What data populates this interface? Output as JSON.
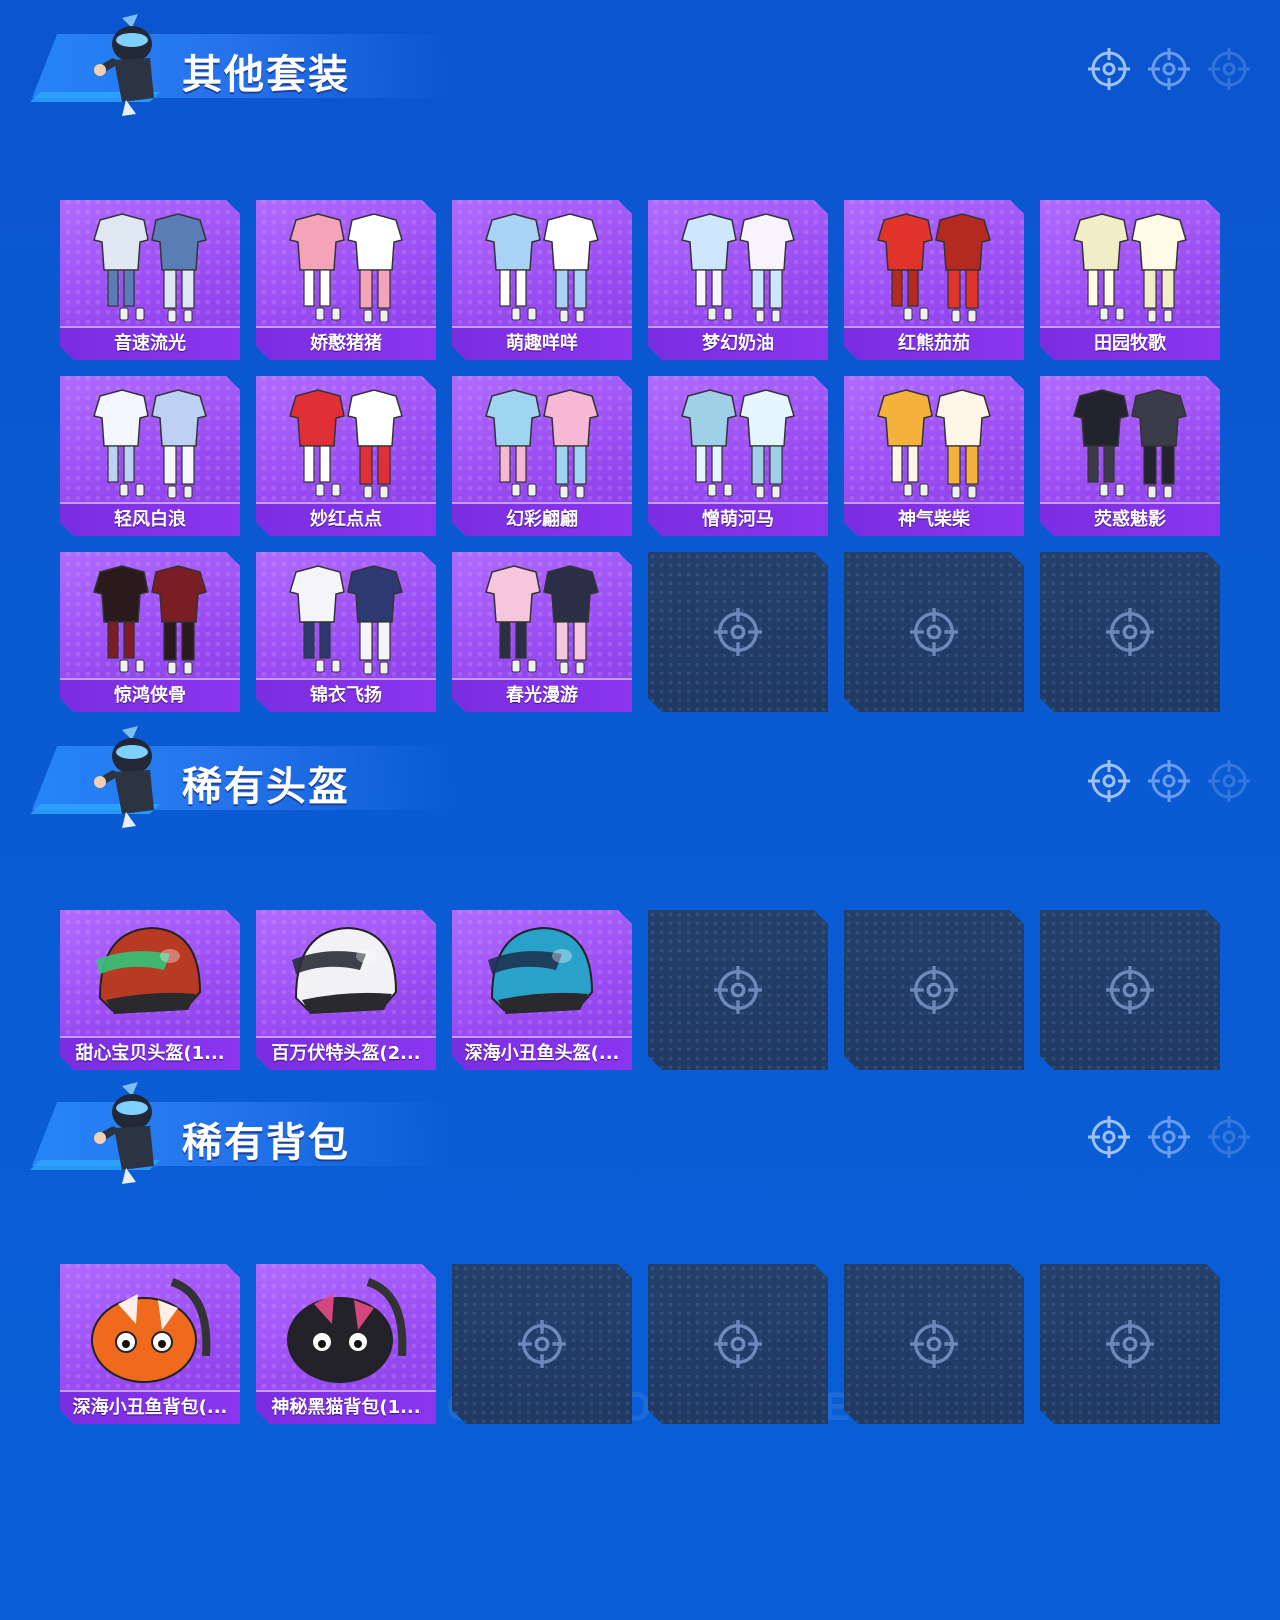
{
  "sections": [
    {
      "title": "其他套装",
      "items": [
        {
          "label": "音速流光",
          "kind": "outfit",
          "colors": [
            "#dfe7f2",
            "#5a7db5"
          ]
        },
        {
          "label": "娇憨猪猪",
          "kind": "outfit",
          "colors": [
            "#f5a3b8",
            "#ffffff"
          ]
        },
        {
          "label": "萌趣咩咩",
          "kind": "outfit",
          "colors": [
            "#a9d3f5",
            "#ffffff"
          ]
        },
        {
          "label": "梦幻奶油",
          "kind": "outfit",
          "colors": [
            "#cfe6ff",
            "#f7f4ff"
          ]
        },
        {
          "label": "红熊茄茄",
          "kind": "outfit",
          "colors": [
            "#e0342a",
            "#b52a20"
          ]
        },
        {
          "label": "田园牧歌",
          "kind": "outfit",
          "colors": [
            "#f1edc6",
            "#fffbe6"
          ]
        },
        {
          "label": "轻风白浪",
          "kind": "outfit",
          "colors": [
            "#f3f5ff",
            "#bcd1f4"
          ]
        },
        {
          "label": "妙红点点",
          "kind": "outfit",
          "colors": [
            "#e02f36",
            "#ffffff"
          ]
        },
        {
          "label": "幻彩翩翩",
          "kind": "outfit",
          "colors": [
            "#9fd5f0",
            "#f7b8d3"
          ]
        },
        {
          "label": "憎萌河马",
          "kind": "outfit",
          "colors": [
            "#9fd0e8",
            "#e5f5ff"
          ]
        },
        {
          "label": "神气柴柴",
          "kind": "outfit",
          "colors": [
            "#f4b23c",
            "#fff5e6"
          ]
        },
        {
          "label": "荧惑魅影",
          "kind": "outfit",
          "colors": [
            "#22232c",
            "#3b3c4a"
          ]
        },
        {
          "label": "惊鸿侠骨",
          "kind": "outfit",
          "colors": [
            "#2a1a1e",
            "#7a1e24"
          ]
        },
        {
          "label": "锦衣飞扬",
          "kind": "outfit",
          "colors": [
            "#f5f5f7",
            "#2d3a72"
          ]
        },
        {
          "label": "春光漫游",
          "kind": "outfit",
          "colors": [
            "#f5c6dc",
            "#2b2f45"
          ]
        }
      ],
      "slots": 18
    },
    {
      "title": "稀有头盔",
      "items": [
        {
          "label": "甜心宝贝头盔(1...",
          "kind": "helmet",
          "colors": [
            "#b83a22",
            "#35c37a"
          ]
        },
        {
          "label": "百万伏特头盔(2...",
          "kind": "helmet",
          "colors": [
            "#f2f2f5",
            "#2a2c38"
          ]
        },
        {
          "label": "深海小丑鱼头盔(...",
          "kind": "helmet",
          "colors": [
            "#2aa1c9",
            "#1c3350"
          ]
        }
      ],
      "slots": 6
    },
    {
      "title": "稀有背包",
      "items": [
        {
          "label": "深海小丑鱼背包(...",
          "kind": "backpack",
          "colors": [
            "#f06a1e",
            "#ffffff"
          ]
        },
        {
          "label": "神秘黑猫背包(1...",
          "kind": "backpack",
          "colors": [
            "#222228",
            "#e84a88"
          ]
        }
      ],
      "slots": 6
    }
  ],
  "watermark": "GAME FOR PEACE"
}
